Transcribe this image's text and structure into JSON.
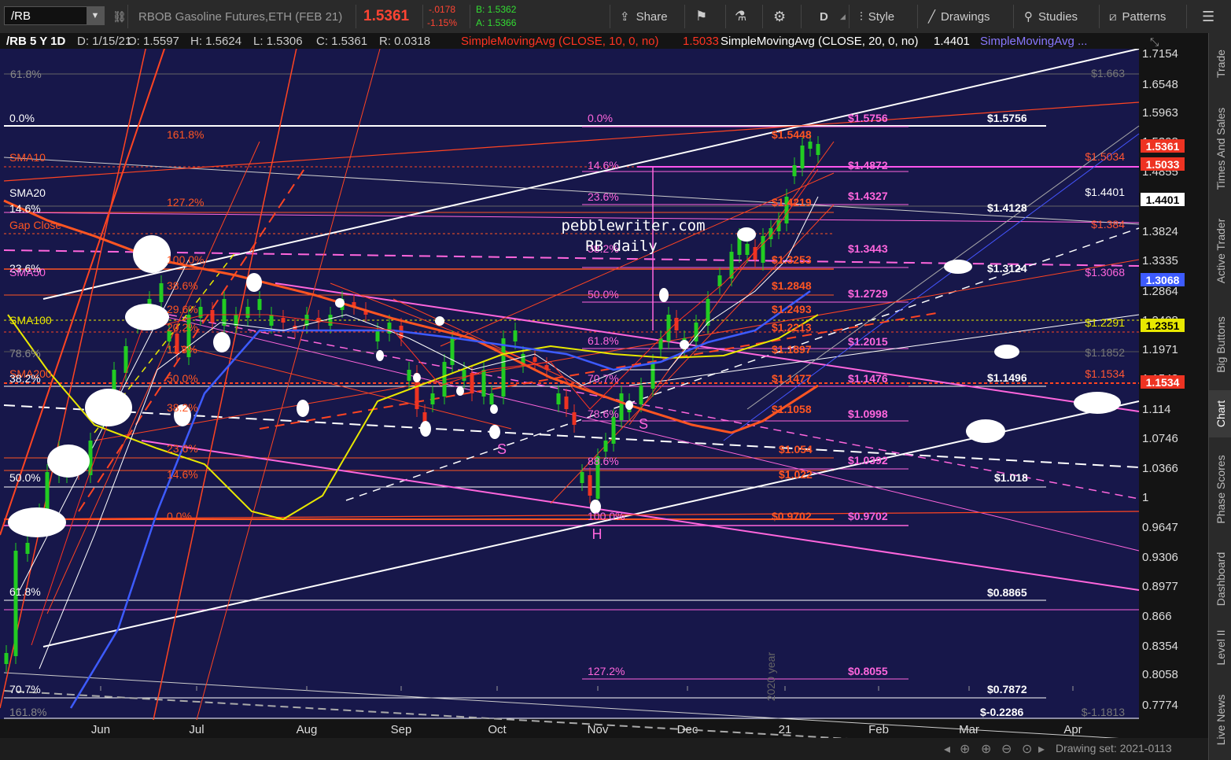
{
  "toolbar": {
    "symbol": "/RB",
    "description": "RBOB Gasoline Futures,ETH (FEB 21)",
    "last": "1.5361",
    "change": "-.0178",
    "change_pct": "-1.15%",
    "bid": "B: 1.5362",
    "ask": "A: 1.5366",
    "share": "Share",
    "period": "D",
    "style": "Style",
    "drawings": "Drawings",
    "studies": "Studies",
    "patterns": "Patterns"
  },
  "sidebar": [
    "Trade",
    "Times And Sales",
    "Active Trader",
    "Big Buttons",
    "Chart",
    "Phase Scores",
    "Dashboard",
    "Level II",
    "Live News"
  ],
  "header": {
    "title": "/RB 5 Y 1D",
    "date": "D: 1/15/21",
    "open": "O: 1.5597",
    "high": "H: 1.5624",
    "low": "L: 1.5306",
    "close": "C: 1.5361",
    "range": "R: 0.0318",
    "sma10": "SimpleMovingAvg (CLOSE, 10, 0, no)",
    "sma10_val": "1.5033",
    "sma20": "SimpleMovingAvg (CLOSE, 20, 0, no)",
    "sma20_val": "1.4401",
    "sma_more": "SimpleMovingAvg ..."
  },
  "colors": {
    "bg": "#17174a",
    "up": "#22cc22",
    "down": "#ee3322",
    "orange": "#ff5a1a",
    "pink": "#ff66dd",
    "white": "#ffffff",
    "yellow": "#e8e800",
    "blue": "#3d5bff"
  },
  "price_axis": [
    "1.7154",
    "1.6548",
    "1.5963",
    "1.5398",
    "1.4855",
    "1.433",
    "1.3824",
    "1.3335",
    "1.2864",
    "1.2408",
    "1.1971",
    "1.1548",
    "1.114",
    "1.0746",
    "1.0366",
    "1",
    "0.9647",
    "0.9306",
    "0.8977",
    "0.866",
    "0.8354",
    "0.8058",
    "0.7774"
  ],
  "price_tags": [
    {
      "text": "1.5361",
      "color": "#ee3322"
    },
    {
      "text": "1.5033",
      "color": "#ee3322"
    },
    {
      "text": "1.4401",
      "color": "#ffffff"
    },
    {
      "text": "1.3068",
      "color": "#3d5bff"
    },
    {
      "text": "1.2351",
      "color": "#e8e800"
    },
    {
      "text": "1.1534",
      "color": "#ee3322"
    }
  ],
  "time_axis": [
    "Jun",
    "Jul",
    "Aug",
    "Sep",
    "Oct",
    "Nov",
    "Dec",
    "21",
    "Feb",
    "Mar",
    "Apr"
  ],
  "drawing_set": "Drawing set: 2021-0113",
  "watermark": "2020 year",
  "annotations": {
    "site": "pebblewriter.com",
    "chart_name": "RB daily",
    "pattern_s1": "S",
    "pattern_s2": "S",
    "pattern_h": "H"
  },
  "fib_left": [
    "61.8%",
    "0.0%",
    "SMA10",
    "SMA20",
    "14.6%",
    "Gap Close",
    "23.6%",
    "SMA50",
    "SMA100",
    "78.6%",
    "SMA200",
    "38.2%",
    "50.0%",
    "61.8%",
    "70.7%",
    "161.8%"
  ],
  "fib_mid_orange": [
    "161.8%",
    "127.2%",
    "100.0%",
    "38.6%",
    "29.6%",
    "20.2%",
    "11.8%",
    "50.0%",
    "38.2%",
    "23.6%",
    "14.6%",
    "0.0%"
  ],
  "fib_mid_pink": [
    "0.0%",
    "14.6%",
    "23.6%",
    "38.2%",
    "50.0%",
    "61.8%",
    "70.7%",
    "78.6%",
    "88.6%",
    "100.0%",
    "127.2%"
  ],
  "fib_orange_prices": [
    "$1.5448",
    "$1.4219",
    "$1.3253",
    "$1.2848",
    "$1.2493",
    "$1.2213",
    "$1.1897",
    "$1.1477",
    "$1.1058",
    "$1.054",
    "$1.022",
    "$0.9702"
  ],
  "fib_pink_prices": [
    "$1.5756",
    "$1.4872",
    "$1.4327",
    "$1.3443",
    "$1.2729",
    "$1.2015",
    "$1.1476",
    "$1.0998",
    "$1.0392",
    "$0.9702",
    "$0.8055"
  ],
  "fib_white_prices": [
    "$1.5756",
    "$1.4128",
    "$1.3124",
    "$1.1496",
    "$1.018",
    "$0.8865",
    "$0.7872",
    "$-0.2286"
  ],
  "right_labels": [
    {
      "text": "$1.663",
      "color": "#777777"
    },
    {
      "text": "$1.5034",
      "color": "#ff5533"
    },
    {
      "text": "$1.4401",
      "color": "#ffffff"
    },
    {
      "text": "$1.384",
      "color": "#ff5533"
    },
    {
      "text": "$1.3068",
      "color": "#ff66dd"
    },
    {
      "text": "$1.2291",
      "color": "#e8e800"
    },
    {
      "text": "$1.1852",
      "color": "#777777"
    },
    {
      "text": "$1.1534",
      "color": "#ff5533"
    },
    {
      "text": "$-1.1813",
      "color": "#777777"
    }
  ]
}
